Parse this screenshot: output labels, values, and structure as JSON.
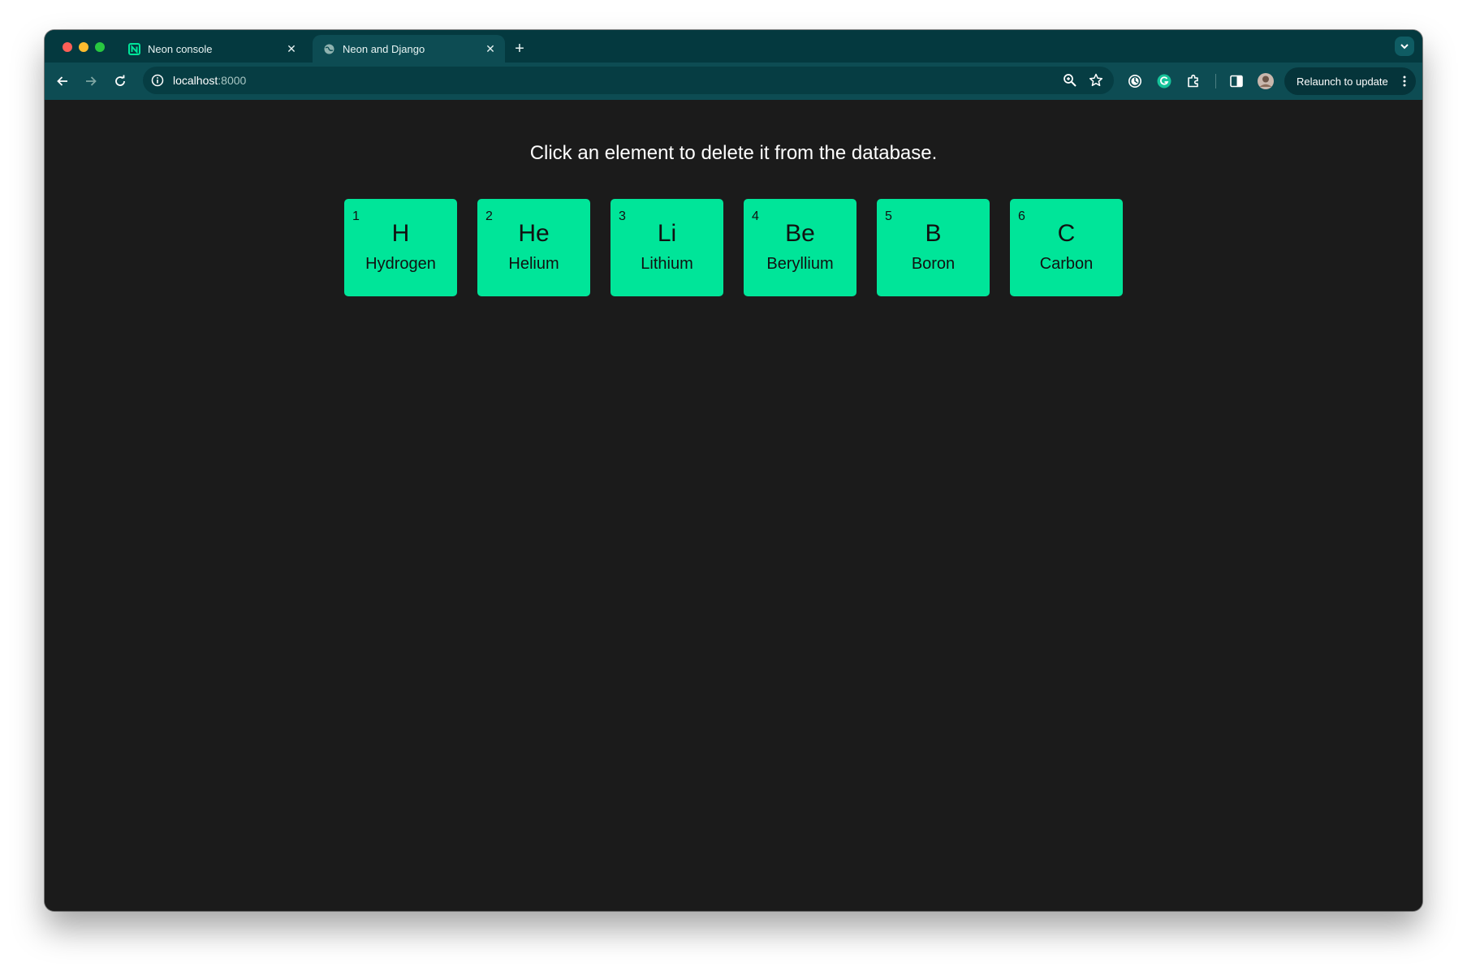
{
  "browser": {
    "tabs": [
      {
        "title": "Neon console",
        "favicon": "neon-logo-icon",
        "active": false
      },
      {
        "title": "Neon and Django",
        "favicon": "globe-icon",
        "active": true
      }
    ],
    "address": {
      "host": "localhost",
      "port": ":8000"
    },
    "relaunch_label": "Relaunch to update",
    "colors": {
      "tabstrip": "#04393f",
      "toolbar": "#0d4c53",
      "omnibox": "#063d43"
    }
  },
  "page": {
    "instruction": "Click an element to delete it from the database.",
    "tile_color": "#00e599",
    "background": "#1b1b1b",
    "elements": [
      {
        "number": "1",
        "symbol": "H",
        "name": "Hydrogen"
      },
      {
        "number": "2",
        "symbol": "He",
        "name": "Helium"
      },
      {
        "number": "3",
        "symbol": "Li",
        "name": "Lithium"
      },
      {
        "number": "4",
        "symbol": "Be",
        "name": "Beryllium"
      },
      {
        "number": "5",
        "symbol": "B",
        "name": "Boron"
      },
      {
        "number": "6",
        "symbol": "C",
        "name": "Carbon"
      }
    ]
  }
}
